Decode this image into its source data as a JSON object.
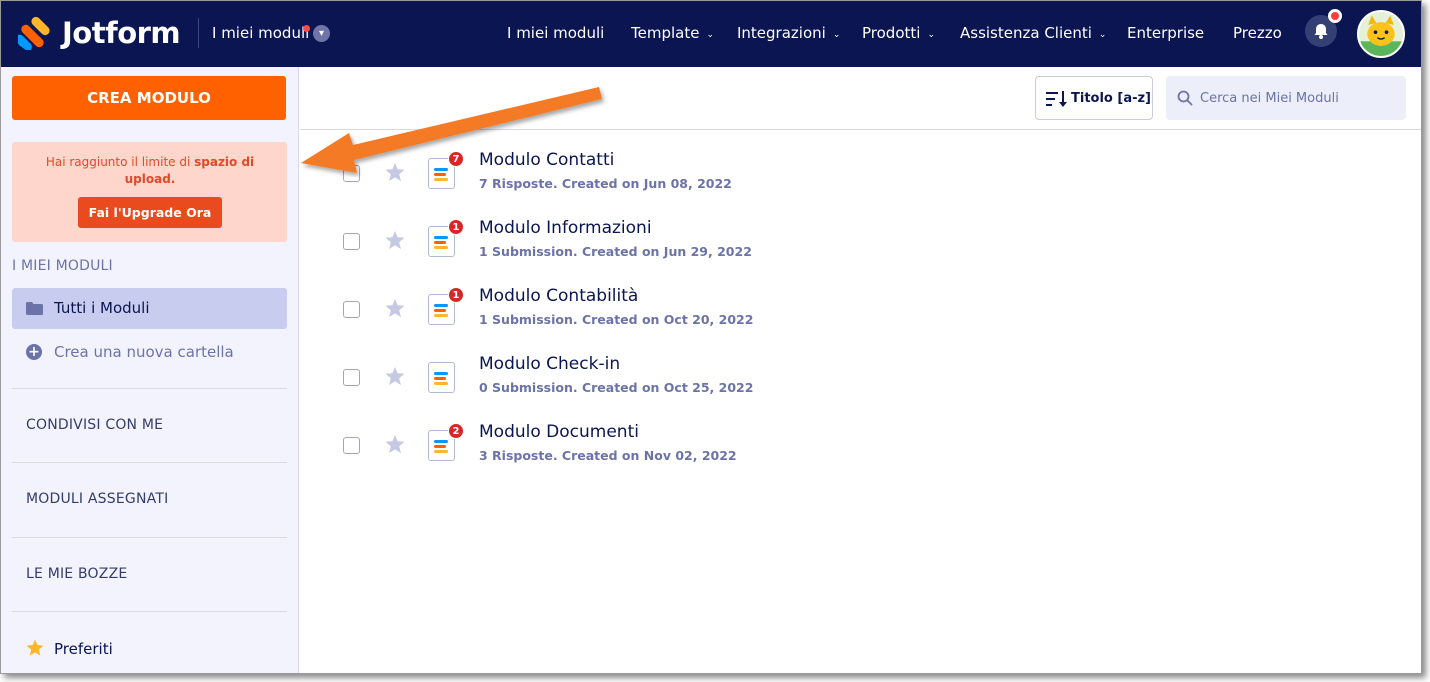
{
  "colors": {
    "nav_bg": "#0a1551",
    "accent": "#ff6100",
    "warning_bg": "#ffd6cb",
    "upgrade_button": "#ea4b1e",
    "sidebar_bg": "#f3f3fe",
    "active_item": "#c8ccee",
    "badge": "#dc2626",
    "annotation_arrow": "#f57a26"
  },
  "header": {
    "brand": "Jotform",
    "my_forms_dropdown": "I miei moduli",
    "nav": [
      {
        "label": "I miei moduli",
        "has_dropdown": false
      },
      {
        "label": "Template",
        "has_dropdown": true
      },
      {
        "label": "Integrazioni",
        "has_dropdown": true
      },
      {
        "label": "Prodotti",
        "has_dropdown": true
      },
      {
        "label": "Assistenza Clienti",
        "has_dropdown": true
      },
      {
        "label": "Enterprise",
        "has_dropdown": false
      },
      {
        "label": "Prezzo",
        "has_dropdown": false
      }
    ],
    "icons": [
      "bell-icon",
      "avatar"
    ]
  },
  "sidebar": {
    "create_button": "CREA MODULO",
    "limit_notice": {
      "text_prefix": "Hai raggiunto il limite di ",
      "text_bold": "spazio di upload.",
      "button": "Fai l'Upgrade Ora"
    },
    "my_forms_heading": "I MIEI MODULI",
    "all_forms": "Tutti i Moduli",
    "new_folder": "Crea una nuova cartella",
    "sections": [
      "CONDIVISI CON ME",
      "MODULI ASSEGNATI",
      "LE MIE BOZZE"
    ],
    "favorites": "Preferiti"
  },
  "toolbar": {
    "sort_label": "Titolo [a-z]",
    "search_placeholder": "Cerca nei Miei Moduli"
  },
  "forms": [
    {
      "title": "Modulo Contatti",
      "meta": "7 Risposte. Created on Jun 08, 2022",
      "badge": "7"
    },
    {
      "title": "Modulo Informazioni",
      "meta": "1 Submission. Created on Jun 29, 2022",
      "badge": "1"
    },
    {
      "title": "Modulo Contabilità",
      "meta": "1 Submission. Created on Oct 20, 2022",
      "badge": "1"
    },
    {
      "title": "Modulo Check-in",
      "meta": "0 Submission. Created on Oct 25, 2022",
      "badge": ""
    },
    {
      "title": "Modulo Documenti",
      "meta": "3 Risposte. Created on Nov 02, 2022",
      "badge": "2"
    }
  ]
}
